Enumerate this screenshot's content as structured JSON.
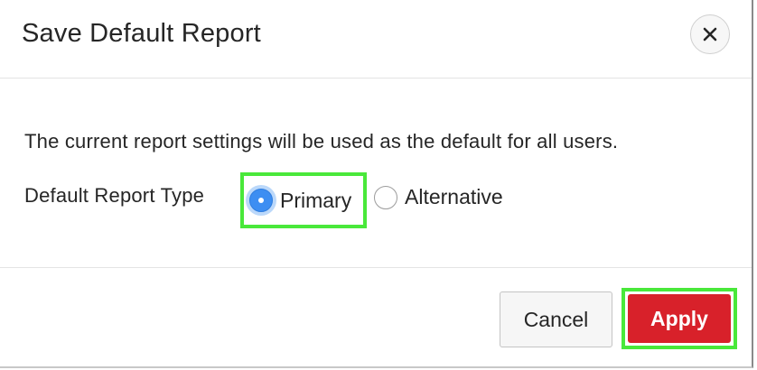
{
  "dialog": {
    "title": "Save Default Report",
    "close_icon": "close-icon",
    "description": "The current report settings will be used as the default for all users.",
    "field_label": "Default Report Type",
    "options": [
      {
        "label": "Primary",
        "selected": true
      },
      {
        "label": "Alternative",
        "selected": false
      }
    ],
    "cancel_label": "Cancel",
    "apply_label": "Apply"
  },
  "colors": {
    "apply_button": "#d8212a",
    "highlight": "#49e83a",
    "radio_selected": "#3d8ef2"
  }
}
